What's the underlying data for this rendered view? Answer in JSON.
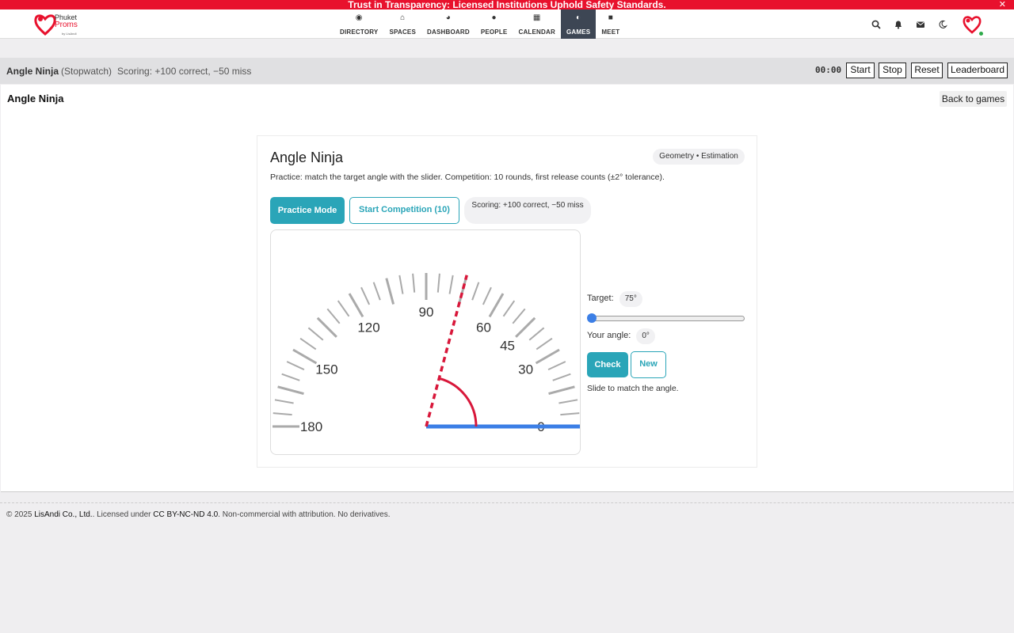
{
  "banner": {
    "text": "Trust in Transparency: Licensed Institutions Uphold Safety Standards.",
    "close": "✕"
  },
  "brand": {
    "line1": "Phuket",
    "line2": "Proms",
    "line3": "by LisAndi"
  },
  "nav": {
    "items": [
      {
        "label": "DIRECTORY",
        "icon": "compass-icon",
        "glyph": "◉"
      },
      {
        "label": "SPACES",
        "icon": "home-icon",
        "glyph": "⌂"
      },
      {
        "label": "DASHBOARD",
        "icon": "gauge-icon",
        "glyph": "◕"
      },
      {
        "label": "PEOPLE",
        "icon": "users-icon",
        "glyph": "●"
      },
      {
        "label": "CALENDAR",
        "icon": "calendar-icon",
        "glyph": "▦"
      },
      {
        "label": "GAMES",
        "icon": "gamepad-icon",
        "glyph": "◐"
      },
      {
        "label": "MEET",
        "icon": "video-icon",
        "glyph": "■"
      }
    ],
    "active": "GAMES"
  },
  "gamebar": {
    "title": "Angle Ninja",
    "subtitle": "(Stopwatch)",
    "scoring": "Scoring: +100 correct, −50 miss",
    "timer": "00:00",
    "start": "Start",
    "stop": "Stop",
    "reset": "Reset",
    "leaderboard": "Leaderboard"
  },
  "panel": {
    "title": "Angle Ninja",
    "back": "Back to games"
  },
  "game": {
    "title": "Angle Ninja",
    "tag": "Geometry • Estimation",
    "description": "Practice: match the target angle with the slider. Competition: 10 rounds, first release counts (±2° tolerance).",
    "practice_label": "Practice Mode",
    "competition_label": "Start Competition (10)",
    "scoring": "Scoring: +100 correct, −50 miss",
    "dial_labels": [
      "0",
      "30",
      "45",
      "60",
      "90",
      "120",
      "150",
      "180"
    ],
    "target_label": "Target:",
    "target_value": "75°",
    "target_degrees": 75,
    "your_angle_label": "Your angle:",
    "your_angle_value": "0°",
    "your_angle_degrees": 0,
    "check_label": "Check",
    "new_label": "New",
    "hint": "Slide to match the angle."
  },
  "footer": {
    "copyright": "© 2025",
    "company": "LisAndi Co., Ltd.",
    "licensed": ". Licensed under",
    "license": "CC BY-NC-ND 4.0",
    "rest": ". Non-commercial with attribution. No derivatives."
  },
  "colors": {
    "accent": "#2aa5b8",
    "brand_red": "#e8112d",
    "target_line": "#d8173a",
    "user_line": "#3c7fe6"
  }
}
